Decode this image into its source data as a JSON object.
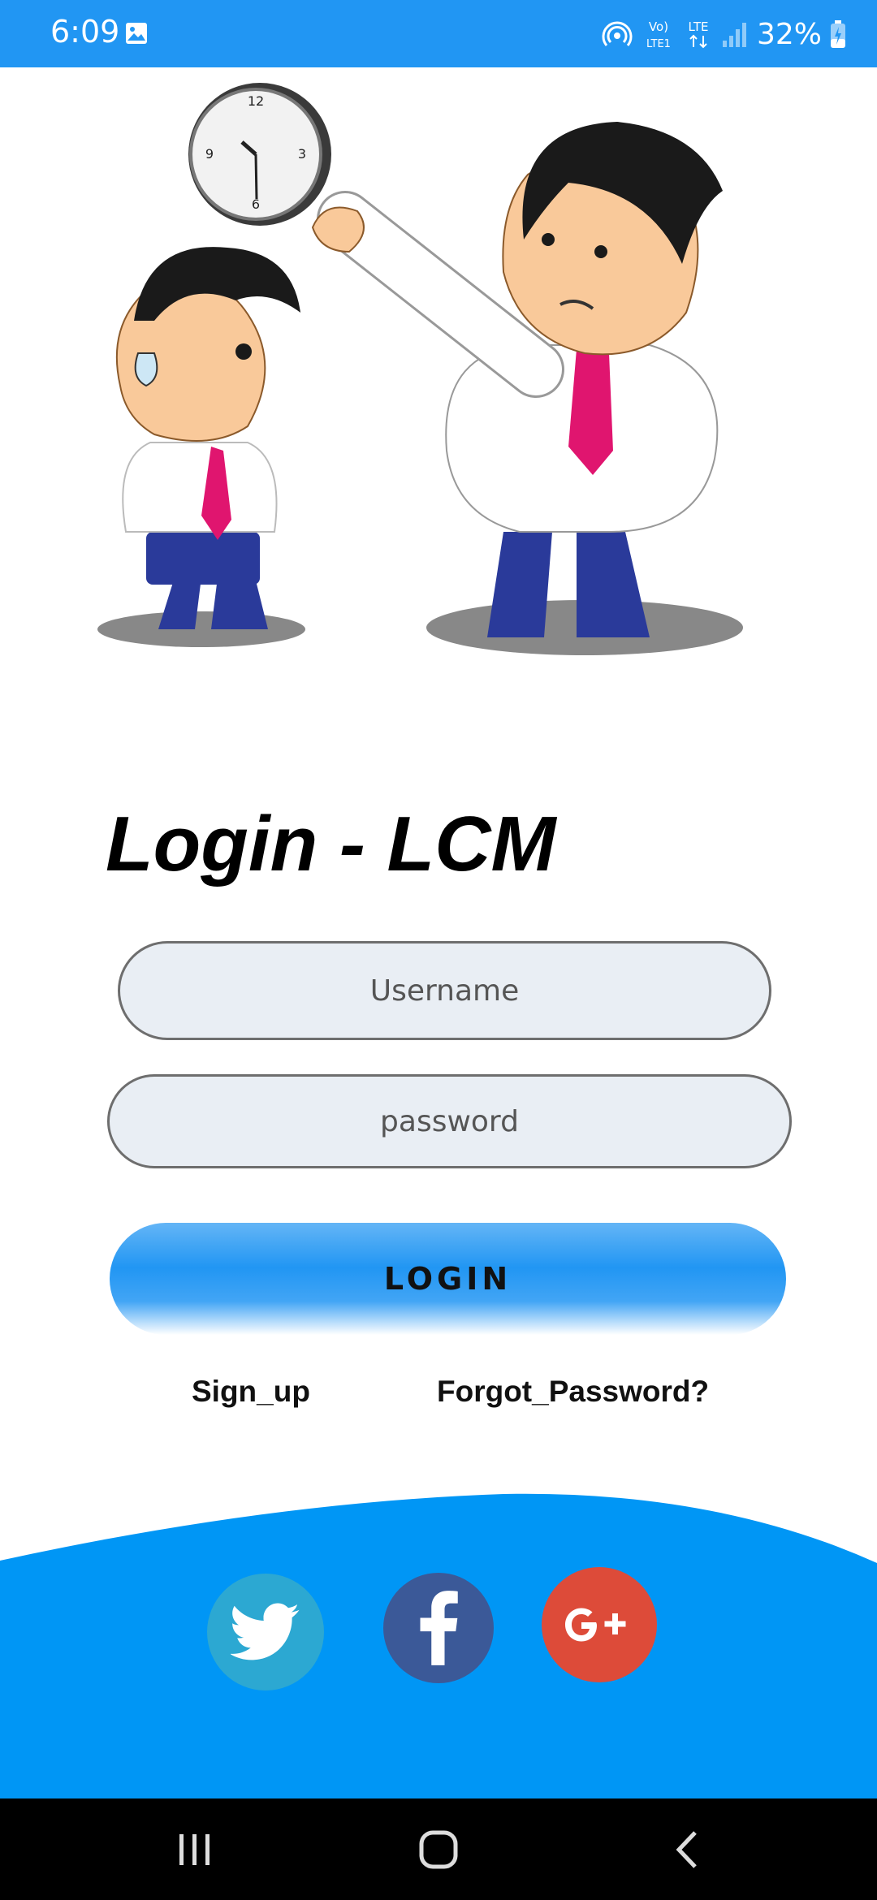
{
  "status_bar": {
    "time": "6:09",
    "battery": "32%",
    "network": "LTE",
    "icons": [
      "gallery-icon",
      "hotspot-icon",
      "volte-icon",
      "lte-icon",
      "signal-icon",
      "battery-icon"
    ],
    "color": "#2196F3"
  },
  "illustration": {
    "icon": "boss-scolding-employee-illustration"
  },
  "login": {
    "title": "Login - LCM",
    "username_placeholder": "Username",
    "password_placeholder": "password",
    "button_label": "LOGIN",
    "signup_label": "Sign_up",
    "forgot_label": "Forgot_Password?"
  },
  "social": {
    "background": "#0096F5",
    "buttons": [
      {
        "name": "twitter",
        "icon": "twitter-icon",
        "color": "#2CA8D2"
      },
      {
        "name": "facebook",
        "icon": "facebook-icon",
        "color": "#3B5998"
      },
      {
        "name": "google-plus",
        "icon": "google-plus-icon",
        "color": "#DD4B39"
      }
    ]
  },
  "nav_bar": {
    "icons": [
      "recent-apps-icon",
      "home-icon",
      "back-icon"
    ]
  }
}
